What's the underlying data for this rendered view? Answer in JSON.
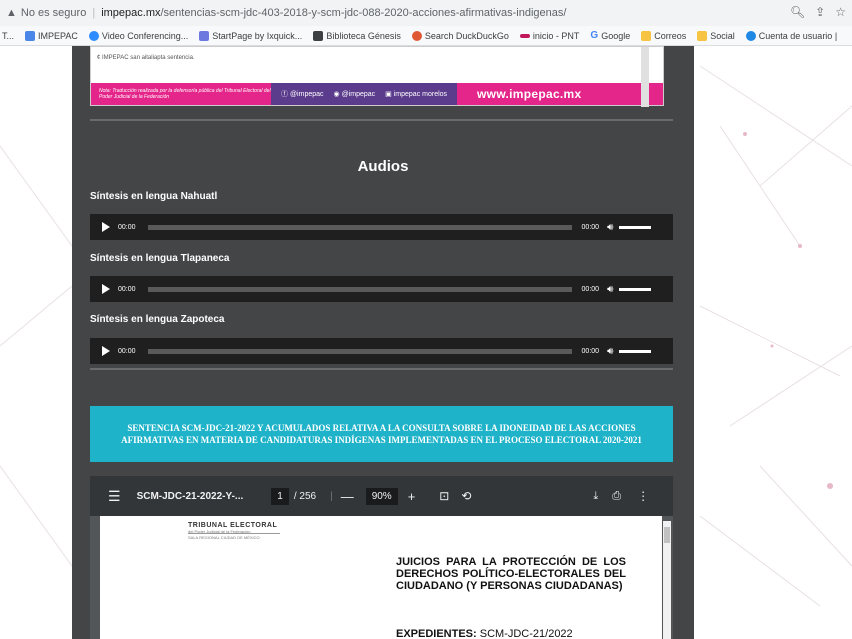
{
  "browser": {
    "security_label": "No es seguro",
    "url_host": "impepac.mx",
    "url_path": "/sentencias-scm-jdc-403-2018-y-scm-jdc-088-2020-acciones-afirmativas-indigenas/",
    "bookmarks": [
      {
        "label": "T..."
      },
      {
        "label": "IMPEPAC",
        "color": "#4a86e8"
      },
      {
        "label": "Video Conferencing...",
        "color": "#2d8cff"
      },
      {
        "label": "StartPage by Ixquick...",
        "color": "#6c7ae0"
      },
      {
        "label": "Biblioteca Génesis",
        "color": "#3c4043"
      },
      {
        "label": "Search DuckDuckGo",
        "color": "#de5833"
      },
      {
        "label": "inicio - PNT",
        "color": "#c2185b"
      },
      {
        "label": "Google",
        "color": "#4285f4"
      },
      {
        "label": "Correos",
        "color": "#f6c342"
      },
      {
        "label": "Social",
        "color": "#f6c342"
      },
      {
        "label": "Cuenta de usuario |",
        "color": "#1e88e5"
      }
    ]
  },
  "infographic": {
    "small_text": "¢ IMPEPAC san aitaliapta sentencia.",
    "note": "Nota: Traducción realizada por la defensoría pública del Tribunal Electoral del Poder Judicial de la Federación",
    "social": [
      "@impepac",
      "@impepac",
      "impepac morelos"
    ],
    "url": "www.impepac.mx"
  },
  "audios": {
    "title": "Audios",
    "items": [
      {
        "label": "Síntesis en lengua Nahuatl",
        "time": "00:00",
        "duration": "00:00"
      },
      {
        "label": "Síntesis en lengua Tlapaneca",
        "time": "00:00",
        "duration": "00:00"
      },
      {
        "label": "Síntesis en lengua Zapoteca",
        "time": "00:00",
        "duration": "00:00"
      }
    ]
  },
  "banner": {
    "text": "SENTENCIA SCM-JDC-21-2022 Y ACUMULADOS RELATIVA A LA CONSULTA SOBRE LA IDONEIDAD DE LAS ACCIONES AFIRMATIVAS EN MATERIA DE CANDIDATURAS INDÍGENAS IMPLEMENTADAS EN EL PROCESO ELECTORAL 2020-2021"
  },
  "pdf": {
    "filename": "SCM-JDC-21-2022-Y-...",
    "page": "1",
    "total": "/ 256",
    "zoom": "90%",
    "org1": "TRIBUNAL ELECTORAL",
    "org2": "del Poder Judicial de la Federación",
    "org3": "SALA REGIONAL CIUDAD DE MÉXICO",
    "heading": "JUICIOS PARA LA PROTECCIÓN DE LOS DERECHOS POLÍTICO-ELECTORALES DEL CIUDADANO (Y PERSONAS CIUDADANAS)",
    "exp_label": "EXPEDIENTES:",
    "exp_value": "SCM-JDC-21/2022"
  }
}
